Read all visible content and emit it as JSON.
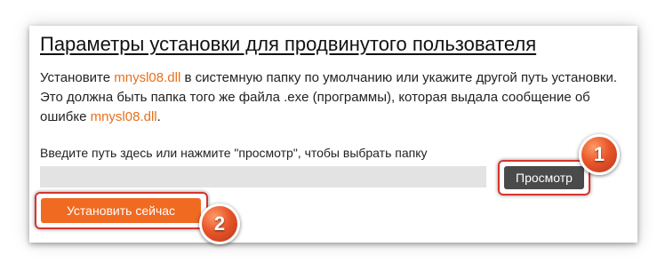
{
  "title": "Параметры установки для продвинутого пользователя",
  "description": {
    "part1": "Установите ",
    "file1": "mnysl08.dll",
    "part2": " в системную папку по умолчанию или укажите другой путь установки. Это должна быть папка того же файла .exe (программы), которая выдала сообщение об ошибке ",
    "file2": "mnysl08.dll",
    "part3": "."
  },
  "path_hint": "Введите путь здесь или нажмите \"просмотр\", чтобы выбрать папку",
  "path_input": {
    "value": "",
    "placeholder": ""
  },
  "browse_button": "Просмотр",
  "install_button": "Установить сейчас",
  "annotations": {
    "badge1": "1",
    "badge2": "2"
  },
  "colors": {
    "filename": "#e8701a",
    "install_button": "#f06a21",
    "browse_button": "#4a4a4a",
    "highlight": "#d6342e",
    "input_bg": "#e3e3e3"
  }
}
